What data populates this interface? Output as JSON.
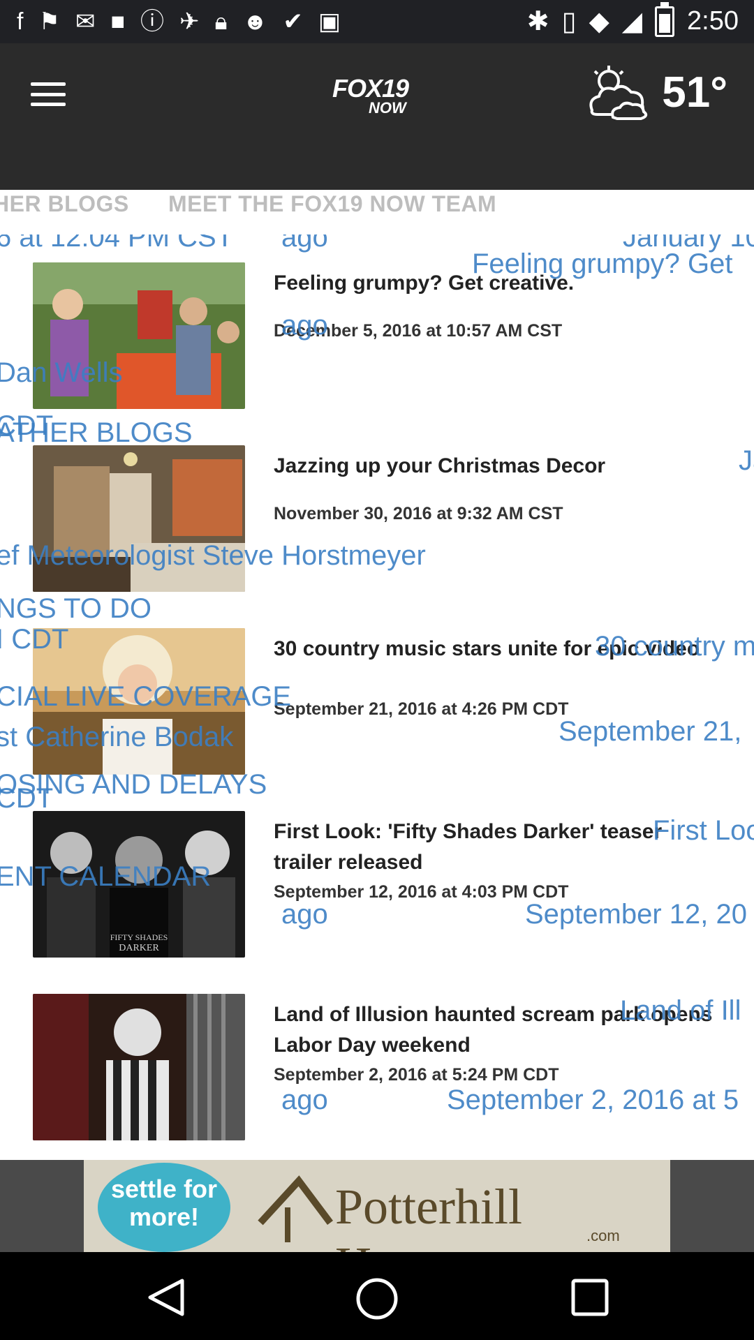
{
  "status_bar": {
    "time": "2:50"
  },
  "header": {
    "logo_line1": "FOX19",
    "logo_line2": "NOW",
    "temperature": "51°"
  },
  "tabs": [
    {
      "label": "HER BLOGS"
    },
    {
      "label": "MEET THE FOX19 NOW TEAM"
    },
    {
      "label": "THINGS TO DO"
    }
  ],
  "articles": [
    {
      "title": "Feeling grumpy? Get creative.",
      "date": "December 5, 2016 at 10:57 AM CST"
    },
    {
      "title": "Jazzing up your Christmas Decor",
      "date": "November 30, 2016 at 9:32 AM CST"
    },
    {
      "title": "30 country music stars unite for epic video",
      "date": "September 21, 2016 at 4:26 PM CDT"
    },
    {
      "title": "First Look:  'Fifty Shades Darker' teaser trailer released",
      "date": "September 12, 2016 at 4:03 PM CDT"
    },
    {
      "title": "Land of Illusion haunted scream park opens Labor Day weekend",
      "date": "September 2, 2016 at 5:24 PM CDT"
    }
  ],
  "overlay_text": [
    "6 at 12:04 PM CST",
    "ago",
    "January 10",
    "Feeling grumpy? Get",
    "ago",
    "Dan Wells",
    "CDT",
    "ATHER BLOGS",
    "Ja",
    "ef Meteorologist Steve Horstmeyer",
    "NGS TO DO",
    "I CDT",
    "30 country m",
    "CIAL LIVE COVERAGE",
    "st Catherine Bodak",
    "September 21,",
    "OSING AND DELAYS",
    "CDT",
    "First Loo",
    "ENT CALENDAR",
    "ago",
    "September 12, 20",
    "Land of Ill",
    "ago",
    "September 2, 2016 at 5"
  ],
  "ad": {
    "badge": "settle for more!",
    "brand": "Potterhill Homes",
    "domain": ".com"
  },
  "colors": {
    "appbar": "#2b2b2b",
    "statusbar": "#202125",
    "overlay_blue": "#3b7fc4"
  }
}
